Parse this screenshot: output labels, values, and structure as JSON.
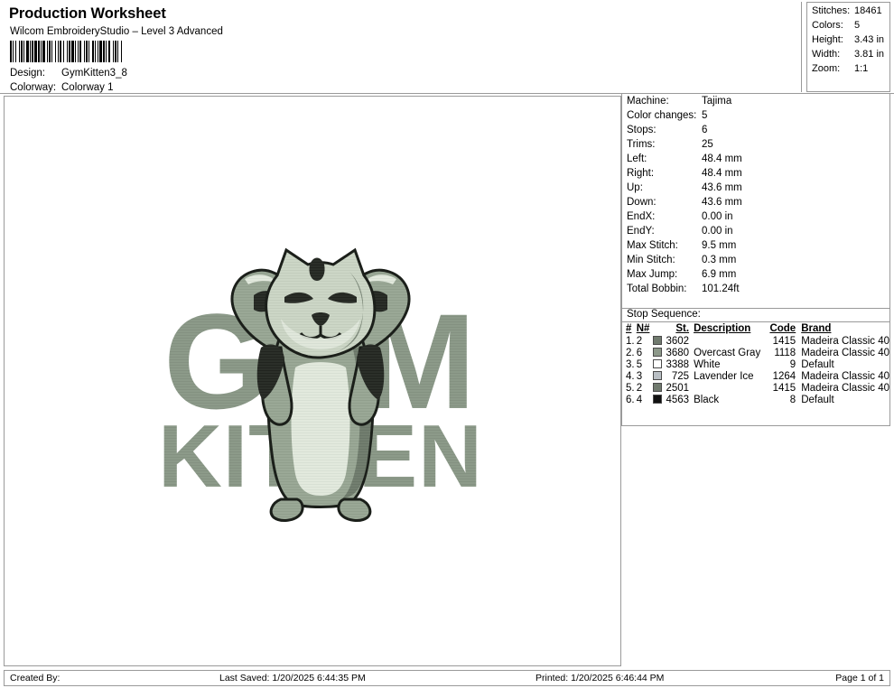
{
  "header": {
    "title": "Production Worksheet",
    "app_name": "Wilcom EmbroideryStudio – Level 3 Advanced",
    "barcode_icon": "barcode",
    "design_label": "Design:",
    "design_value": "GymKitten3_8",
    "colorway_label": "Colorway:",
    "colorway_value": "Colorway 1"
  },
  "stats": [
    {
      "label": "Stitches:",
      "value": "18461"
    },
    {
      "label": "Colors:",
      "value": "5"
    },
    {
      "label": "Height:",
      "value": "3.43 in"
    },
    {
      "label": "Width:",
      "value": "3.81 in"
    },
    {
      "label": "Zoom:",
      "value": "1:1"
    }
  ],
  "design_preview": {
    "artwork_name": "gym-kitten-embroidery-design",
    "background_text": "GYM",
    "foreground_text": "KITTEN",
    "subject": "flexing muscular cat",
    "colors": {
      "text_fill": "#8c9a89",
      "text_fill_light": "#9fae9c",
      "body_fill": "#9aa896",
      "body_light": "#ccd6c6",
      "belly": "#e2e9dd",
      "shadow": "#5d6a59",
      "dark": "#2b2f29",
      "outline": "#1b1f1a"
    }
  },
  "machine_details": [
    {
      "label": "Machine:",
      "value": "Tajima"
    },
    {
      "label": "Color changes:",
      "value": "5"
    },
    {
      "label": "Stops:",
      "value": "6"
    },
    {
      "label": "Trims:",
      "value": "25"
    },
    {
      "label": "Left:",
      "value": "48.4 mm"
    },
    {
      "label": "Right:",
      "value": "48.4 mm"
    },
    {
      "label": "Up:",
      "value": "43.6 mm"
    },
    {
      "label": "Down:",
      "value": "43.6 mm"
    },
    {
      "label": "EndX:",
      "value": "0.00 in"
    },
    {
      "label": "EndY:",
      "value": "0.00 in"
    },
    {
      "label": "Max Stitch:",
      "value": "9.5 mm"
    },
    {
      "label": "Min Stitch:",
      "value": "0.3 mm"
    },
    {
      "label": "Max Jump:",
      "value": "6.9 mm"
    },
    {
      "label": "Total Bobbin:",
      "value": "101.24ft"
    }
  ],
  "stop_sequence": {
    "title": "Stop Sequence:",
    "columns": {
      "num": "#",
      "needle": "N#",
      "stitches": "St.",
      "description": "Description",
      "code": "Code",
      "brand": "Brand"
    },
    "rows": [
      {
        "num": "1.",
        "needle": "2",
        "swatch": "#707a6e",
        "stitches": "3602",
        "description": "",
        "code": "1415",
        "brand": "Madeira Classic 40"
      },
      {
        "num": "2.",
        "needle": "6",
        "swatch": "#8d998a",
        "stitches": "3680",
        "description": "Overcast Gray",
        "code": "1118",
        "brand": "Madeira Classic 40"
      },
      {
        "num": "3.",
        "needle": "5",
        "swatch": "#ffffff",
        "stitches": "3388",
        "description": "White",
        "code": "9",
        "brand": "Default"
      },
      {
        "num": "4.",
        "needle": "3",
        "swatch": "#b9bfc4",
        "stitches": "725",
        "description": "Lavender Ice",
        "code": "1264",
        "brand": "Madeira Classic 40"
      },
      {
        "num": "5.",
        "needle": "2",
        "swatch": "#707a6e",
        "stitches": "2501",
        "description": "",
        "code": "1415",
        "brand": "Madeira Classic 40"
      },
      {
        "num": "6.",
        "needle": "4",
        "swatch": "#111111",
        "stitches": "4563",
        "description": "Black",
        "code": "8",
        "brand": "Default"
      }
    ]
  },
  "footer": {
    "created_by": "Created By:",
    "last_saved": "Last Saved: 1/20/2025 6:44:35 PM",
    "printed": "Printed: 1/20/2025 6:46:44 PM",
    "page": "Page 1 of 1"
  }
}
